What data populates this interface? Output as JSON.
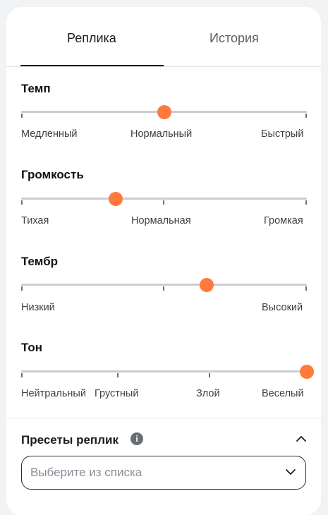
{
  "tabs": [
    {
      "label": "Реплика",
      "active": true
    },
    {
      "label": "История",
      "active": false
    }
  ],
  "sliders": [
    {
      "title": "Темп",
      "value": 0.5,
      "labels": [
        "Медленный",
        "Нормальный",
        "Быстрый"
      ]
    },
    {
      "title": "Громкость",
      "value": 0.33,
      "labels": [
        "Тихая",
        "Нормальная",
        "Громкая"
      ]
    },
    {
      "title": "Тембр",
      "value": 0.65,
      "labels": [
        "Низкий",
        "Высокий"
      ]
    },
    {
      "title": "Тон",
      "value": 1.0,
      "labels": [
        "Нейтральный",
        "Грустный",
        "Злой",
        "Веселый"
      ]
    }
  ],
  "presets": {
    "title": "Пресеты реплик",
    "info_icon": "info-icon",
    "collapse_icon": "chevron-up-icon",
    "select_placeholder": "Выберите из списка",
    "select_icon": "chevron-down-icon"
  },
  "colors": {
    "accent": "#ff7a3c",
    "track": "#c9ccd3",
    "text": "#1c1c1e"
  }
}
